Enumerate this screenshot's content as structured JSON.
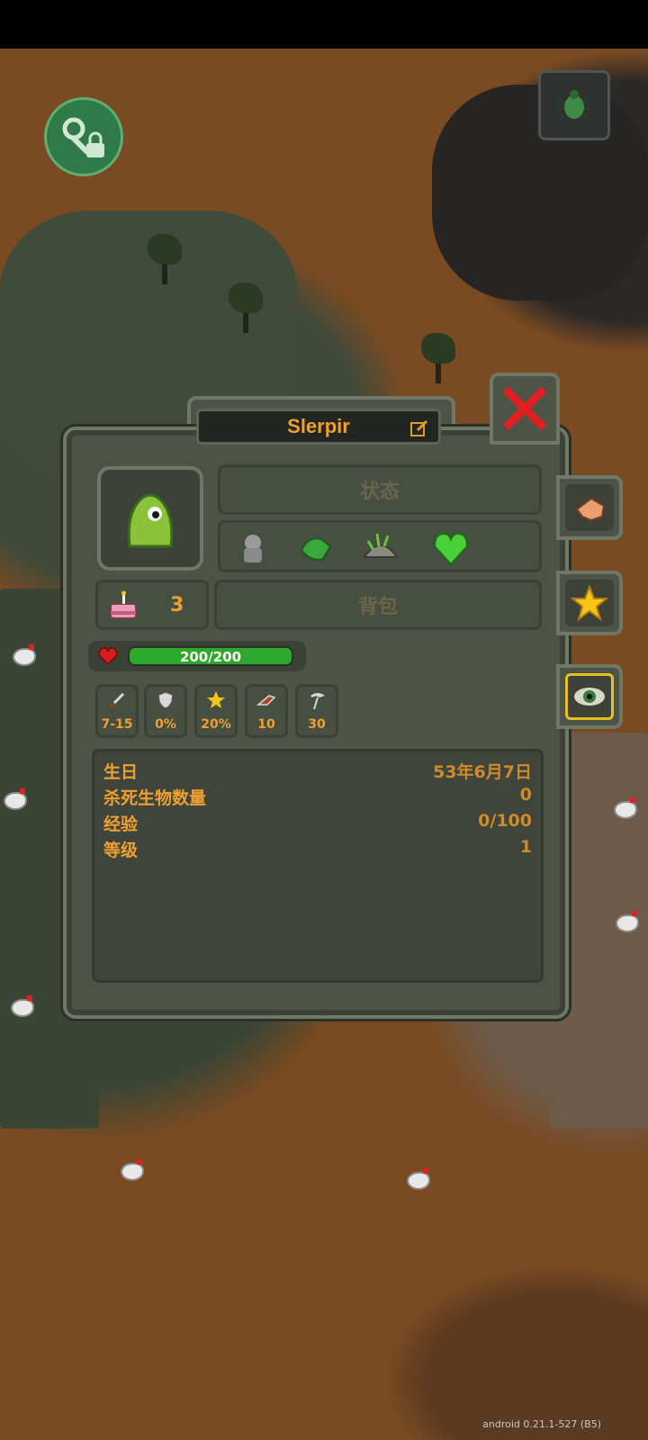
{
  "character": {
    "name": "Slerpir",
    "age": "3",
    "hp_text": "200/200",
    "hp_fraction": 1.0
  },
  "tabs": {
    "status_label": "状态",
    "inventory_label": "背包"
  },
  "stats": [
    {
      "icon": "sword-icon",
      "value": "7-15"
    },
    {
      "icon": "shield-icon",
      "value": "0%"
    },
    {
      "icon": "crit-star-icon",
      "value": "20%"
    },
    {
      "icon": "speed-icon",
      "value": "10"
    },
    {
      "icon": "scythe-icon",
      "value": "30"
    }
  ],
  "info": [
    {
      "key": "生日",
      "value": "53年6月7日"
    },
    {
      "key": "杀死生物数量",
      "value": "0"
    },
    {
      "key": "经验",
      "value": "0/100"
    },
    {
      "key": "等级",
      "value": "1"
    }
  ],
  "traits": [
    "stone-golem-icon",
    "green-hand-icon",
    "grass-helmet-icon",
    "green-heart-icon"
  ],
  "side_tabs": [
    "hand-icon",
    "star-icon",
    "eye-icon"
  ],
  "colors": {
    "accent": "#f0a030",
    "hp": "#2ea82a",
    "close": "#e02020"
  },
  "version": "android 0.21.1-527 (B5)"
}
